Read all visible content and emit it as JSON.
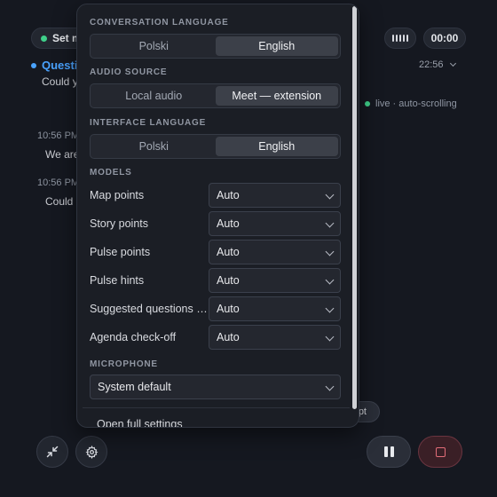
{
  "background": {
    "set_pill_label": "Set m",
    "timer": "00:00",
    "question_label": "Questi",
    "question_sub": "Could y",
    "question_time": "22:56",
    "live_status": "live · auto-scrolling",
    "entries": [
      {
        "time": "10:56 PM",
        "text": "We are"
      },
      {
        "time": "10:56 PM",
        "text": "Could"
      }
    ],
    "transcript_pill": "pt"
  },
  "settings": {
    "conversation_language": {
      "title": "CONVERSATION LANGUAGE",
      "options": [
        "Polski",
        "English"
      ],
      "selected": "English"
    },
    "audio_source": {
      "title": "AUDIO SOURCE",
      "options": [
        "Local audio",
        "Meet — extension"
      ],
      "selected": "Meet — extension"
    },
    "interface_language": {
      "title": "INTERFACE LANGUAGE",
      "options": [
        "Polski",
        "English"
      ],
      "selected": "English"
    },
    "models": {
      "title": "MODELS",
      "rows": [
        {
          "label": "Map points",
          "value": "Auto"
        },
        {
          "label": "Story points",
          "value": "Auto"
        },
        {
          "label": "Pulse points",
          "value": "Auto"
        },
        {
          "label": "Pulse hints",
          "value": "Auto"
        },
        {
          "label": "Suggested questions …",
          "value": "Auto"
        },
        {
          "label": "Agenda check-off",
          "value": "Auto"
        }
      ]
    },
    "microphone": {
      "title": "MICROPHONE",
      "value": "System default"
    },
    "open_full_settings": "Open full settings"
  },
  "colors": {
    "accent_blue": "#4aa3ff",
    "live_green": "#3fd08a",
    "stop_red": "#e26d78"
  }
}
